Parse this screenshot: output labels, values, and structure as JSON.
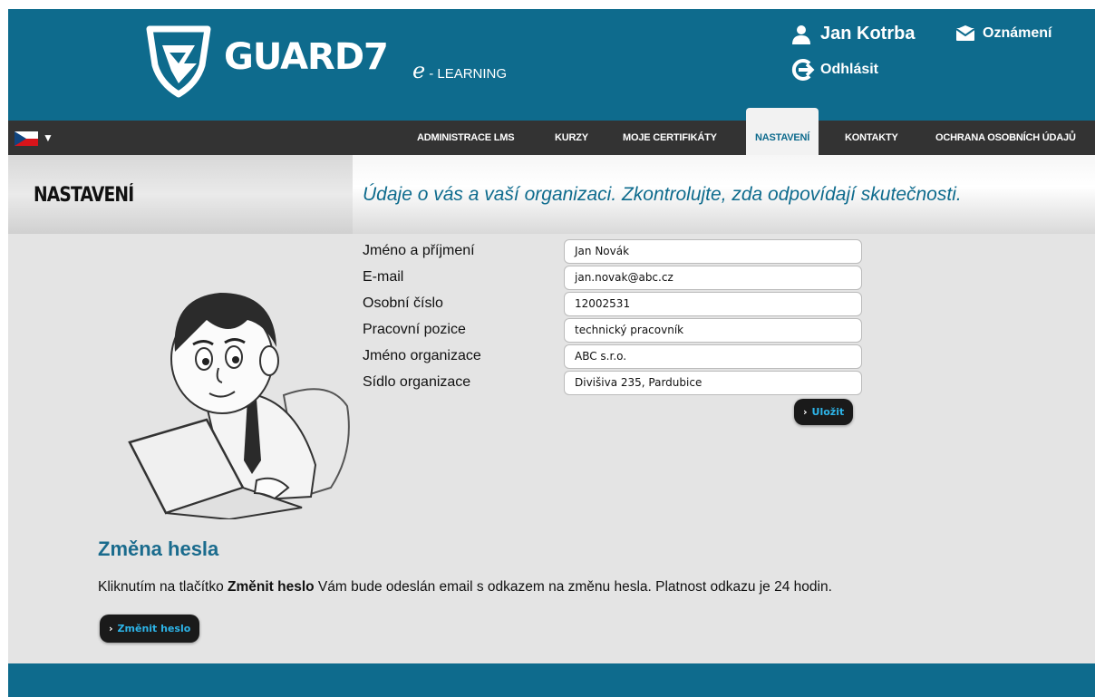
{
  "header": {
    "brand": "GUARD7",
    "brand_e": "e",
    "brand_sub": "- LEARNING",
    "user_name": "Jan Kotrba",
    "notifications_label": "Oznámení",
    "logout_label": "Odhlásit"
  },
  "nav": {
    "items": [
      {
        "label": "ADMINISTRACE LMS"
      },
      {
        "label": "KURZY"
      },
      {
        "label": "MOJE CERTIFIKÁTY"
      },
      {
        "label": "NASTAVENÍ",
        "active": true
      },
      {
        "label": "KONTAKTY"
      },
      {
        "label": "OCHRANA OSOBNÍCH ÚDAJŮ"
      }
    ]
  },
  "page": {
    "title": "NASTAVENÍ",
    "subtitle": "Údaje o vás a vaší organizaci. Zkontrolujte, zda odpovídají skutečnosti."
  },
  "form": {
    "fields": [
      {
        "label": "Jméno a příjmení",
        "value": "Jan Novák"
      },
      {
        "label": "E-mail",
        "value": "jan.novak@abc.cz"
      },
      {
        "label": "Osobní číslo",
        "value": "12002531"
      },
      {
        "label": "Pracovní pozice",
        "value": "technický pracovník"
      },
      {
        "label": "Jméno organizace",
        "value": "ABC s.r.o."
      },
      {
        "label": "Sídlo organizace",
        "value": "Divišiva 235, Pardubice"
      }
    ],
    "save_label": "Uložit"
  },
  "password": {
    "title": "Změna hesla",
    "text_before": "Kliknutím na tlačítko ",
    "text_bold": "Změnit heslo",
    "text_after": " Vám bude odeslán email s odkazem na změnu hesla. Platnost odkazu je 24 hodin.",
    "button_label": "Změnit heslo"
  },
  "colors": {
    "brand_blue": "#0e6b8d",
    "nav_dark": "#333333",
    "accent_cyan": "#2db4e8"
  }
}
